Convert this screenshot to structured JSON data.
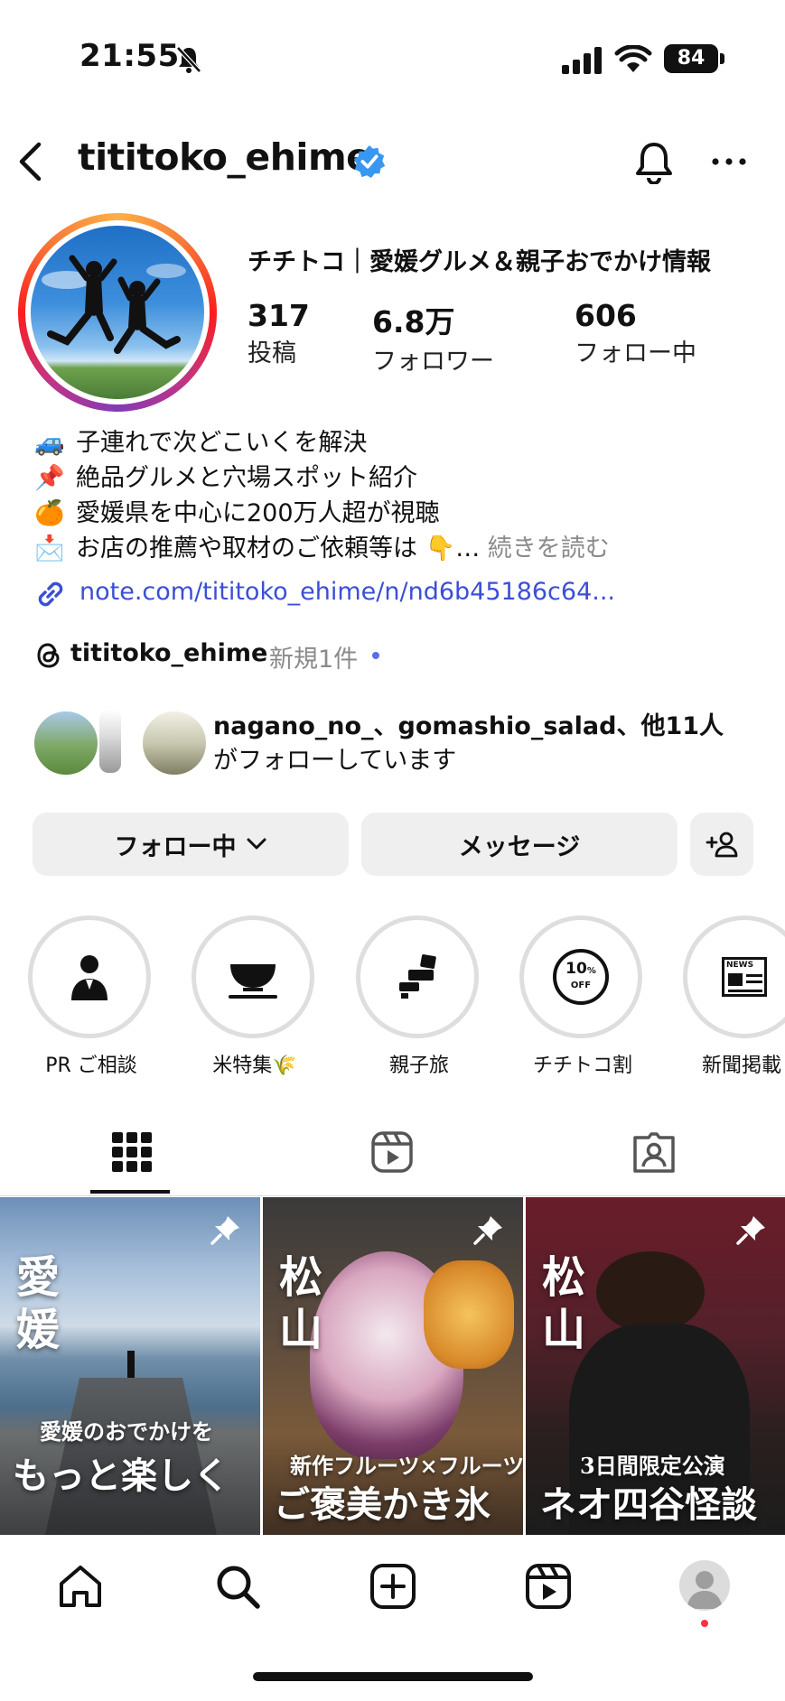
{
  "status_bar": {
    "time": "21:55",
    "battery": "84"
  },
  "header": {
    "username": "tititoko_ehime"
  },
  "profile": {
    "full_name": "チチトコ｜愛媛グルメ＆親子おでかけ情報",
    "stats": [
      {
        "value": "317",
        "label": "投稿"
      },
      {
        "value": "6.8万",
        "label": "フォロワー"
      },
      {
        "value": "606",
        "label": "フォロー中"
      }
    ],
    "bio": [
      {
        "emoji": "🚙",
        "text": "子連れで次どこいくを解決"
      },
      {
        "emoji": "📌",
        "text": "絶品グルメと穴場スポット紹介"
      },
      {
        "emoji": "🍊",
        "text": "愛媛県を中心に200万人超が視聴"
      },
      {
        "emoji": "📩",
        "text": "お店の推薦や取材のご依頼等は 👇…"
      }
    ],
    "bio_more": "続きを読む",
    "link": "note.com/tititoko_ehime/n/nd6b45186c64...",
    "threads": {
      "name": "tititoko_ehime",
      "badge": "新規1件"
    },
    "mutual": {
      "line1": "nagano_no_、gomashio_salad、他11人",
      "line2": "がフォローしています"
    }
  },
  "buttons": {
    "following": "フォロー中",
    "message": "メッセージ"
  },
  "highlights": [
    {
      "label": "PR ご相談",
      "icon": "person-icon"
    },
    {
      "label": "米特集🌾",
      "icon": "rice-bowl-icon"
    },
    {
      "label": "親子旅",
      "icon": "seat-icon"
    },
    {
      "label": "チチトコ割",
      "icon": "discount-icon",
      "badge_top": "10",
      "badge_unit": "%",
      "badge_bottom": "OFF"
    },
    {
      "label": "新聞掲載",
      "icon": "newspaper-icon",
      "badge": "NEWS"
    }
  ],
  "posts": [
    {
      "big": [
        "愛",
        "媛"
      ],
      "sub": "愛媛のおでかけを",
      "title": "もっと楽しく",
      "pinned": true
    },
    {
      "big": [
        "松",
        "山"
      ],
      "sub": "新作フルーツ×フルーツ",
      "title": "ご褒美かき氷",
      "pinned": true
    },
    {
      "big": [
        "松",
        "山"
      ],
      "sub": "3日間限定公演",
      "title": "ネオ四谷怪談",
      "pinned": true
    }
  ],
  "colors": {
    "link": "#3b4fd6",
    "verified": "#3897f0",
    "notification_dot": "#ff3040"
  }
}
